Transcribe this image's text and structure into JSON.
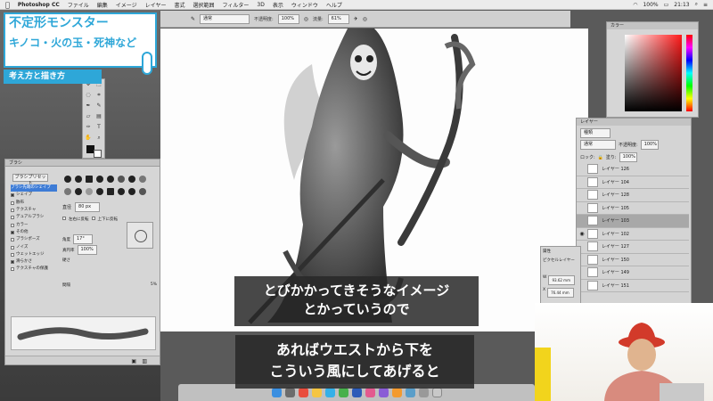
{
  "menubar": {
    "app_name": "Photoshop CC",
    "items": [
      "ファイル",
      "編集",
      "イメージ",
      "レイヤー",
      "書式",
      "選択範囲",
      "フィルター",
      "3D",
      "表示",
      "ウィンドウ",
      "ヘルプ"
    ],
    "battery": "100%",
    "time": "21:13"
  },
  "options_bar": {
    "mode_value": "通常",
    "opacity_label": "不透明度:",
    "opacity_value": "100%",
    "flow_label": "流量:",
    "flow_value": "61%"
  },
  "title_card": {
    "line1": "不定形モンスター",
    "line2": "キノコ・火の玉・死神など",
    "sub": "考え方と描き方"
  },
  "brush_panel": {
    "header": "ブラシ",
    "preset_button": "ブラシプリセット",
    "options": [
      "ブラシ先端のシェイプ",
      "シェイプ",
      "散布",
      "テクスチャ",
      "デュアルブラシ",
      "カラー",
      "その他",
      "ブラシポーズ",
      "ノイズ",
      "ウェットエッジ",
      "滑らかさ",
      "テクスチャの保護"
    ],
    "options_checked": [
      false,
      true,
      false,
      false,
      false,
      false,
      true,
      false,
      false,
      false,
      true,
      false
    ],
    "size_label": "直径",
    "size_value": "80 px",
    "flip_x": "左右に反転",
    "flip_y": "上下に反転",
    "angle_label": "角度",
    "angle_value": "17°",
    "roundness_label": "真円率",
    "roundness_value": "100%",
    "hardness_label": "硬さ",
    "spacing_label": "間隔",
    "spacing_value": "5%"
  },
  "color_panel": {
    "header": "カラー",
    "hue_color": "#ff1a1a"
  },
  "layers_panel": {
    "header": "レイヤー",
    "kind": "種類",
    "blend_mode": "通常",
    "opacity_label": "不透明度:",
    "opacity_value": "100%",
    "fill_label": "塗り:",
    "fill_value": "100%",
    "lock_label": "ロック:",
    "rows": [
      {
        "name": "レイヤー 126",
        "visible": false,
        "selected": false,
        "green": false
      },
      {
        "name": "レイヤー 104",
        "visible": false,
        "selected": false,
        "green": true
      },
      {
        "name": "レイヤー 128",
        "visible": false,
        "selected": false,
        "green": false
      },
      {
        "name": "レイヤー 105",
        "visible": false,
        "selected": false,
        "green": true
      },
      {
        "name": "レイヤー 103",
        "visible": false,
        "selected": true,
        "green": false
      },
      {
        "name": "レイヤー 102",
        "visible": true,
        "selected": false,
        "green": false
      },
      {
        "name": "レイヤー 127",
        "visible": false,
        "selected": false,
        "green": false
      },
      {
        "name": "レイヤー 150",
        "visible": false,
        "selected": false,
        "green": false
      },
      {
        "name": "レイヤー 149",
        "visible": false,
        "selected": false,
        "green": false
      },
      {
        "name": "レイヤー 151",
        "visible": false,
        "selected": false,
        "green": false
      }
    ]
  },
  "properties_panel": {
    "header": "属性",
    "kind": "ピクセルレイヤー",
    "w_label": "W",
    "w_value": "93.62 mm",
    "x_label": "X",
    "x_value": "76.44 mm"
  },
  "subtitles": {
    "top_line1": "とびかかってきそうなイメージ",
    "top_line2": "とかっていうので",
    "bottom_line1": "あればウエストから下を",
    "bottom_line2": "こういう風にしてあげると"
  },
  "accent_color": "#2ea7d8"
}
